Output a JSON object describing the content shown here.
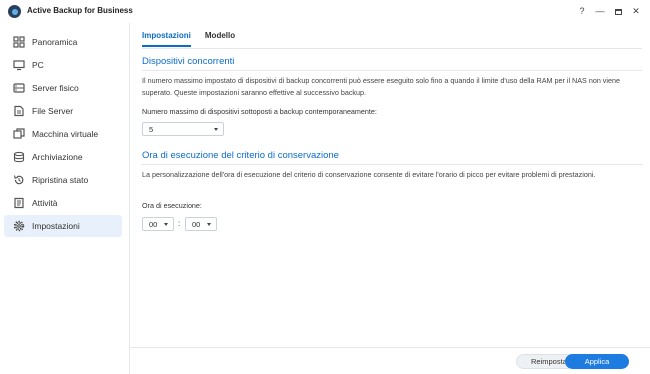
{
  "window": {
    "title": "Active Backup for Business",
    "help": "?",
    "minimize": "—",
    "close": "✕"
  },
  "sidebar": {
    "items": [
      {
        "label": "Panoramica",
        "icon": "dashboard-icon"
      },
      {
        "label": "PC",
        "icon": "pc-icon"
      },
      {
        "label": "Server fisico",
        "icon": "server-icon"
      },
      {
        "label": "File Server",
        "icon": "file-server-icon"
      },
      {
        "label": "Macchina virtuale",
        "icon": "virtual-machine-icon"
      },
      {
        "label": "Archiviazione",
        "icon": "storage-icon"
      },
      {
        "label": "Ripristina stato",
        "icon": "restore-icon"
      },
      {
        "label": "Attività",
        "icon": "activity-icon"
      },
      {
        "label": "Impostazioni",
        "icon": "gear-icon",
        "active": true
      }
    ]
  },
  "tabs": [
    {
      "label": "Impostazioni",
      "active": true
    },
    {
      "label": "Modello",
      "active": false
    }
  ],
  "section1": {
    "title": "Dispositivi concorrenti",
    "description": "Il numero massimo impostato di dispositivi di backup concorrenti può essere eseguito solo fino a quando il limite d'uso della RAM per il NAS non viene superato. Queste impostazioni saranno effettive al successivo backup.",
    "field_label": "Numero massimo di dispositivi sottoposti a backup contemporaneamente:",
    "select_value": "5"
  },
  "section2": {
    "title": "Ora di esecuzione del criterio di conservazione",
    "description": "La personalizzazione dell'ora di esecuzione del criterio di conservazione consente di evitare l'orario di picco per evitare problemi di prestazioni.",
    "field_label": "Ora di esecuzione:",
    "hour": "00",
    "separator": ":",
    "minute": "00"
  },
  "footer": {
    "reset_label": "Reimposta",
    "apply_label": "Applica"
  },
  "colors": {
    "accent": "#0c6ccb",
    "apply_button": "#1e7be0",
    "active_nav_bg": "#e8f1fb"
  }
}
